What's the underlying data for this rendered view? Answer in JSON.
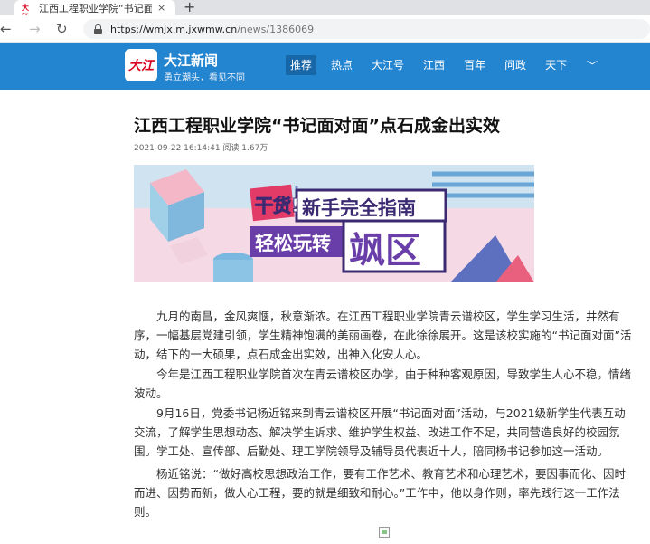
{
  "browser": {
    "tab_title": "江西工程职业学院“书记面对面”点",
    "tab_favicon_text": "大江",
    "tab_close": "×",
    "new_tab": "+",
    "url_host": "https://wmjx.m.jxwmw.cn",
    "url_path": "/news/1386069",
    "back": "←",
    "forward": "→",
    "reload": "↻"
  },
  "site": {
    "logo_text": "大江",
    "brand_name": "大江新闻",
    "slogan": "勇立潮头，看见不同",
    "nav": [
      "推荐",
      "热点",
      "大江号",
      "江西",
      "百年",
      "问政",
      "天下"
    ],
    "nav_more": "﹀",
    "colors": {
      "header": "#2384d0",
      "active_nav": "#1766a8"
    }
  },
  "article": {
    "title": "江西工程职业学院“书记面对面”点石成金出实效",
    "meta": "2021-09-22 16:14:41 阅读 1.67万",
    "banner": {
      "line1_badge": "干货!",
      "line1": "新手完全指南",
      "line2": "轻松玩转",
      "line2_big": "飒区"
    },
    "paragraphs": [
      "九月的南昌，金风爽惬，秋意渐浓。在江西工程职业学院青云谱校区，学生学习生活，井然有序，一幅基层党建引领，学生精神饱满的美丽画卷，在此徐徐展开。这是该校实施的“书记面对面”活动，结下的一大硕果，点石成金出实效，出神入化安人心。",
      "今年是江西工程职业学院首次在青云谱校区办学，由于种种客观原因，导致学生人心不稳，情绪波动。",
      "9月16日，党委书记杨近铭来到青云谱校区开展“书记面对面”活动，与2021级新学生代表互动交流，了解学生思想动态、解决学生诉求、维护学生权益、改进工作不足，共同营造良好的校园氛围。学工处、宣传部、后勤处、理工学院领导及辅导员代表近十人，陪同杨书记参加这一活动。",
      "杨近铭说：“做好高校思想政治工作，要有工作艺术、教育艺术和心理艺术，要因事而化、因时而进、因势而新，做人心工程，要的就是细致和耐心。”工作中，他以身作则，率先践行这一工作法则。"
    ]
  }
}
